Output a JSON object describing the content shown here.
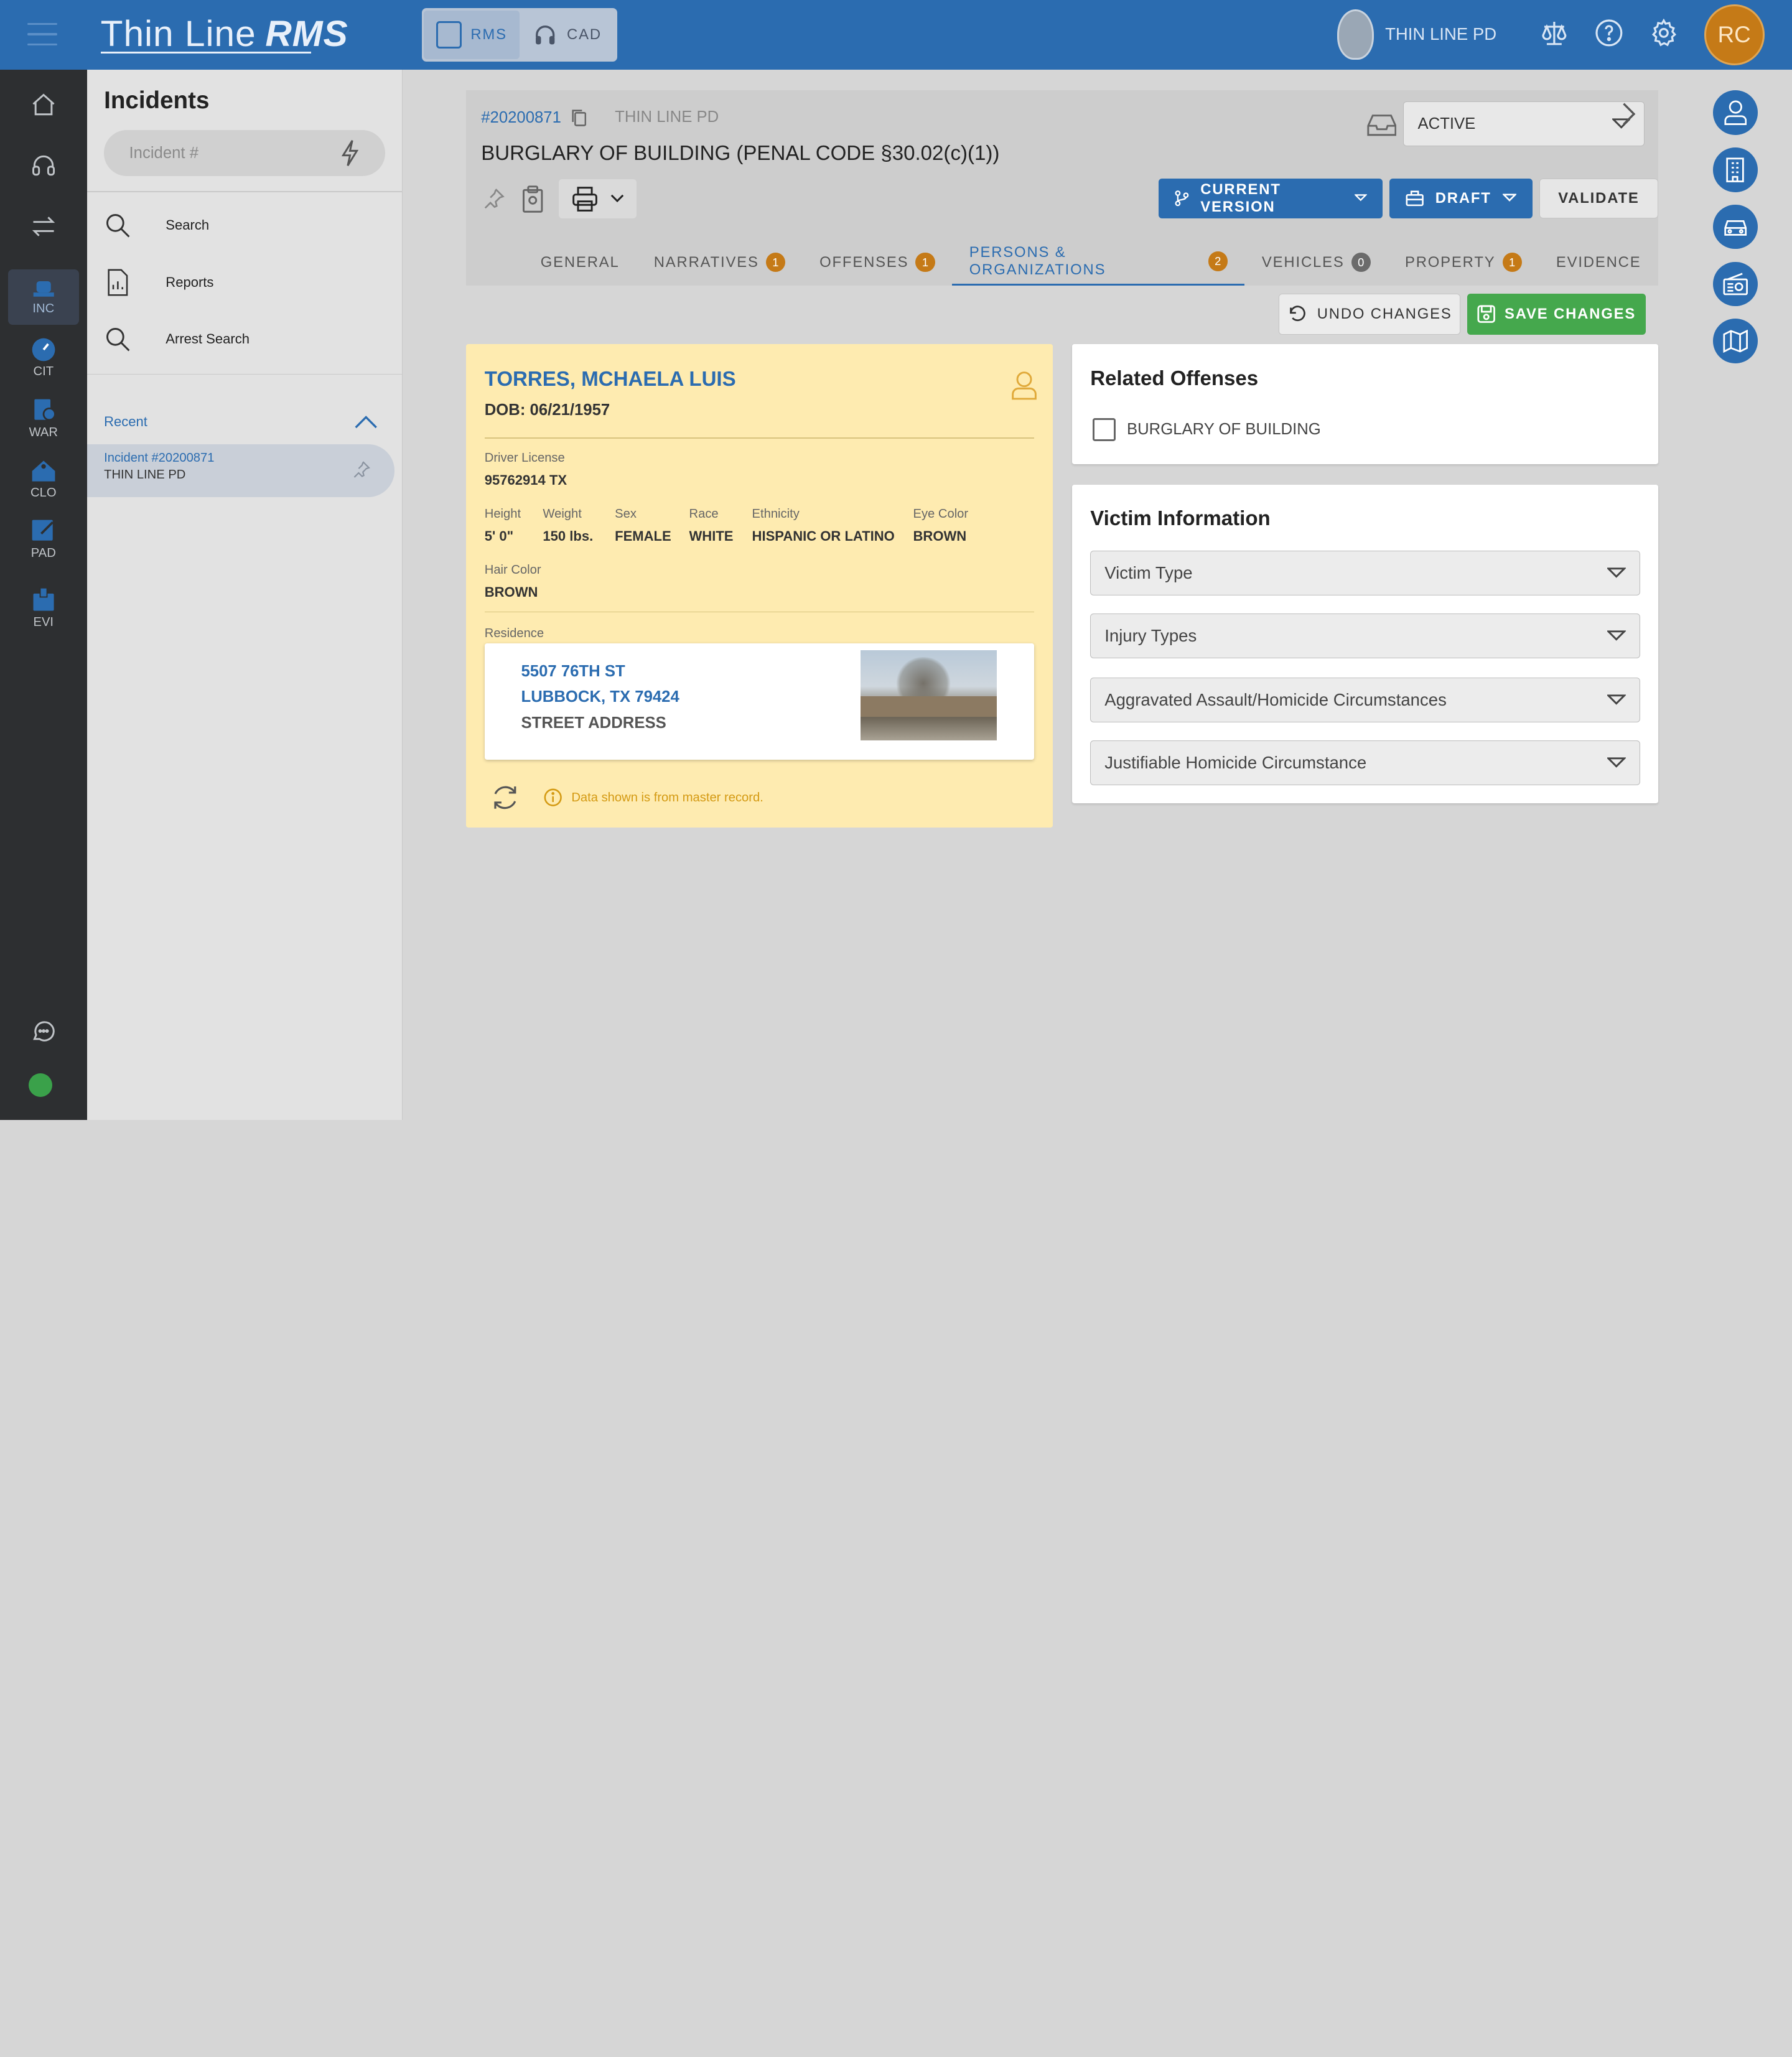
{
  "topbar": {
    "logo_thin": "Thin Line",
    "logo_rms": "RMS",
    "modules": [
      {
        "label": "RMS",
        "active": true
      },
      {
        "label": "CAD",
        "active": false
      }
    ],
    "org_name": "THIN LINE PD",
    "icons": [
      "scales-icon",
      "help-icon",
      "settings-icon"
    ],
    "avatar_initials": "RC"
  },
  "leftnav": {
    "items": [
      {
        "label": "",
        "icon": "home-icon"
      },
      {
        "label": "",
        "icon": "headset-icon"
      },
      {
        "label": "",
        "icon": "transfer-icon"
      },
      {
        "label": "INC",
        "icon": "police-light-icon",
        "active": true
      },
      {
        "label": "CIT",
        "icon": "speedometer-icon"
      },
      {
        "label": "WAR",
        "icon": "warrant-icon"
      },
      {
        "label": "CLO",
        "icon": "crime-lab-icon"
      },
      {
        "label": "PAD",
        "icon": "notepad-icon"
      },
      {
        "label": "EVI",
        "icon": "evidence-box-icon"
      }
    ],
    "chat_icon": "chat-icon",
    "status_color": "#3aa14a"
  },
  "sidepanel": {
    "title": "Incidents",
    "search_placeholder": "Incident #",
    "links": [
      {
        "label": "Search",
        "icon": "search-icon"
      },
      {
        "label": "Reports",
        "icon": "report-icon"
      },
      {
        "label": "Arrest Search",
        "icon": "search-icon"
      }
    ],
    "recent_label": "Recent",
    "recent_items": [
      {
        "title": "Incident #20200871",
        "subtitle": "THIN LINE PD"
      }
    ]
  },
  "incident": {
    "number": "#20200871",
    "org": "THIN LINE PD",
    "title": "BURGLARY OF BUILDING (PENAL CODE §30.02(c)(1))",
    "status": "ACTIVE",
    "buttons": {
      "version": "CURRENT VERSION",
      "draft": "DRAFT",
      "validate": "VALIDATE"
    },
    "tabs": [
      {
        "label": "GENERAL",
        "count": null
      },
      {
        "label": "NARRATIVES",
        "count": "1"
      },
      {
        "label": "OFFENSES",
        "count": "1"
      },
      {
        "label": "PERSONS & ORGANIZATIONS",
        "count": "2",
        "active": true
      },
      {
        "label": "VEHICLES",
        "count": "0"
      },
      {
        "label": "PROPERTY",
        "count": "1"
      },
      {
        "label": "EVIDENCE",
        "count": null
      }
    ]
  },
  "actions": {
    "undo": "UNDO CHANGES",
    "save": "SAVE CHANGES"
  },
  "person": {
    "name": "TORRES, MCHAELA LUIS",
    "dob": "DOB: 06/21/1957",
    "dl_label": "Driver License",
    "dl_value": "95762914 TX",
    "attributes": [
      {
        "label": "Height",
        "value": "5' 0\""
      },
      {
        "label": "Weight",
        "value": "150 lbs."
      },
      {
        "label": "Sex",
        "value": "FEMALE"
      },
      {
        "label": "Race",
        "value": "WHITE"
      },
      {
        "label": "Ethnicity",
        "value": "HISPANIC OR LATINO"
      },
      {
        "label": "Eye Color",
        "value": "BROWN"
      }
    ],
    "hair_label": "Hair Color",
    "hair_value": "BROWN",
    "residence_label": "Residence",
    "address_line1": "5507 76TH ST",
    "address_line2": "LUBBOCK, TX 79424",
    "address_type": "STREET ADDRESS",
    "info_note": "Data shown is from master record."
  },
  "related_offenses": {
    "title": "Related Offenses",
    "items": [
      {
        "label": "BURGLARY OF BUILDING",
        "checked": false
      }
    ]
  },
  "victim_info": {
    "title": "Victim Information",
    "fields": [
      {
        "placeholder": "Victim Type"
      },
      {
        "placeholder": "Injury Types"
      },
      {
        "placeholder": "Aggravated Assault/Homicide Circumstances"
      },
      {
        "placeholder": "Justifiable Homicide Circumstance"
      }
    ]
  },
  "rail": [
    "person-icon",
    "building-icon",
    "car-icon",
    "radio-icon",
    "map-icon"
  ],
  "colors": {
    "brand": "#2b6cb0",
    "accent": "#c57a17",
    "success": "#45a84d",
    "card": "#feebb0"
  }
}
